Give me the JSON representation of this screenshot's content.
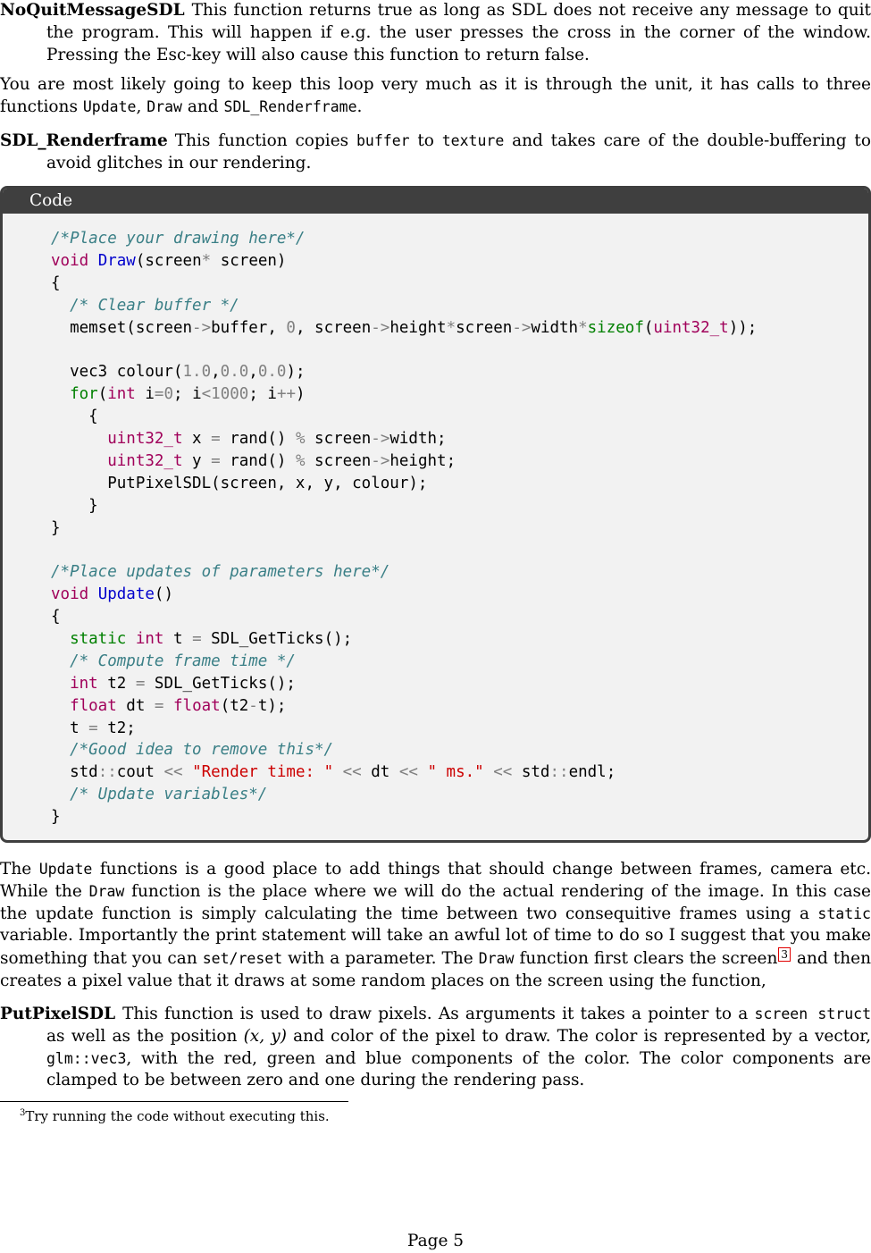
{
  "desc1": {
    "term": "NoQuitMessageSDL",
    "text": "This function returns true as long as SDL does not receive any message to quit the program. This will happen if e.g. the user presses the cross in the corner of the window. Pressing the Esc-key will also cause this function to return false."
  },
  "para1": {
    "text_a": "You are most likely going to keep this loop very much as it is through the unit, it has calls to three functions ",
    "code_update": "Update",
    "sep1": ", ",
    "code_draw": "Draw",
    "sep2": " and ",
    "code_render": "SDL_Renderframe",
    "end": "."
  },
  "desc2": {
    "term": "SDL_Renderframe",
    "text_a": "This function copies ",
    "code_buffer": "buffer",
    "text_b": " to ",
    "code_texture": "texture",
    "text_c": " and takes care of the double-buffering to avoid glitches in our rendering."
  },
  "code_box": {
    "header": "Code",
    "lines": {
      "l1": "/*Place your drawing here*/",
      "l2_void": "void",
      "l2_fn": "Draw",
      "l2_rest": "(screen",
      "l2_star": "*",
      "l2_end": " screen)",
      "l3": "{",
      "l4": "  /* Clear buffer */",
      "l5_a": "  memset(screen",
      "l5_arrow1": "->",
      "l5_b": "buffer, ",
      "l5_zero": "0",
      "l5_c": ", screen",
      "l5_arrow2": "->",
      "l5_d": "height",
      "l5_star1": "*",
      "l5_e": "screen",
      "l5_arrow3": "->",
      "l5_f": "width",
      "l5_star2": "*",
      "l5_sizeof": "sizeof",
      "l5_g": "(",
      "l5_type": "uint32_t",
      "l5_h": "));",
      "l7_a": "  vec3 colour(",
      "l7_n1": "1.0",
      "l7_c1": ",",
      "l7_n2": "0.0",
      "l7_c2": ",",
      "l7_n3": "0.0",
      "l7_b": ");",
      "l8_for": "  for",
      "l8_p": "(",
      "l8_int": "int",
      "l8_a": " i",
      "l8_eq": "=",
      "l8_zero": "0",
      "l8_b": "; i",
      "l8_lt": "<",
      "l8_num": "1000",
      "l8_c": "; i",
      "l8_pp": "++",
      "l8_d": ")",
      "l9": "    {",
      "l10_indent": "      ",
      "l10_type": "uint32_t",
      "l10_a": " x ",
      "l10_eq": "=",
      "l10_b": " rand() ",
      "l10_mod": "%",
      "l10_c": " screen",
      "l10_arrow": "->",
      "l10_d": "width;",
      "l11_indent": "      ",
      "l11_type": "uint32_t",
      "l11_a": " y ",
      "l11_eq": "=",
      "l11_b": " rand() ",
      "l11_mod": "%",
      "l11_c": " screen",
      "l11_arrow": "->",
      "l11_d": "height;",
      "l12": "      PutPixelSDL(screen, x, y, colour);",
      "l13": "    }",
      "l14": "}",
      "l16": "/*Place updates of parameters here*/",
      "l17_void": "void",
      "l17_fn": " Update",
      "l17_rest": "()",
      "l18": "{",
      "l19_static": "  static",
      "l19_int": " int",
      "l19_a": " t ",
      "l19_eq": "=",
      "l19_b": " SDL_GetTicks();",
      "l20": "  /* Compute frame time */",
      "l21_int": "  int",
      "l21_a": " t2 ",
      "l21_eq": "=",
      "l21_b": " SDL_GetTicks();",
      "l22_float": "  float",
      "l22_a": " dt ",
      "l22_eq": "=",
      "l22_float2": " float",
      "l22_b": "(t2",
      "l22_minus": "-",
      "l22_c": "t);",
      "l23_a": "  t ",
      "l23_eq": "=",
      "l23_b": " t2;",
      "l24": "  /*Good idea to remove this*/",
      "l25_a": "  std",
      "l25_cc1": "::",
      "l25_b": "cout ",
      "l25_op1": "<<",
      "l25_s1": " \"Render time: \"",
      "l25_op2": " <<",
      "l25_c": " dt ",
      "l25_op3": "<<",
      "l25_s2": " \" ms.\"",
      "l25_op4": " <<",
      "l25_d": " std",
      "l25_cc2": "::",
      "l25_e": "endl;",
      "l26": "  /* Update variables*/",
      "l27": "}"
    }
  },
  "para2": {
    "t1": "The ",
    "c_update": "Update",
    "t2": " functions is a good place to add things that should change between frames, camera etc. While the ",
    "c_draw": "Draw",
    "t3": " function is the place where we will do the actual rendering of the image. In this case the update function is simply calculating the time between two consequitive frames using a ",
    "c_static": "static",
    "t4": " variable. Importantly the print statement will take an awful lot of time to do so I suggest that you make something that you can ",
    "c_setreset": "set/reset",
    "t5": " with a parameter. The ",
    "c_draw2": "Draw",
    "t6": " function first clears the screen",
    "fn_ref": "3",
    "t7": " and then creates a pixel value that it draws at some random places on the screen using the function,"
  },
  "desc3": {
    "term": "PutPixelSDL",
    "t1": "This function is used to draw pixels. As arguments it takes a pointer to a ",
    "c_screen": "screen struct",
    "t2": " as well as the position ",
    "pos": "(x, y)",
    "t3": " and color of the pixel to draw.  The color is represented by a vector, ",
    "c_vec": "glm::vec3",
    "t4": ", with the red, green and blue components of the color. The color components are clamped to be between zero and one during the rendering pass."
  },
  "footnote": {
    "num": "3",
    "text": "Try running the code without executing this."
  },
  "page": {
    "label": "Page 5"
  }
}
